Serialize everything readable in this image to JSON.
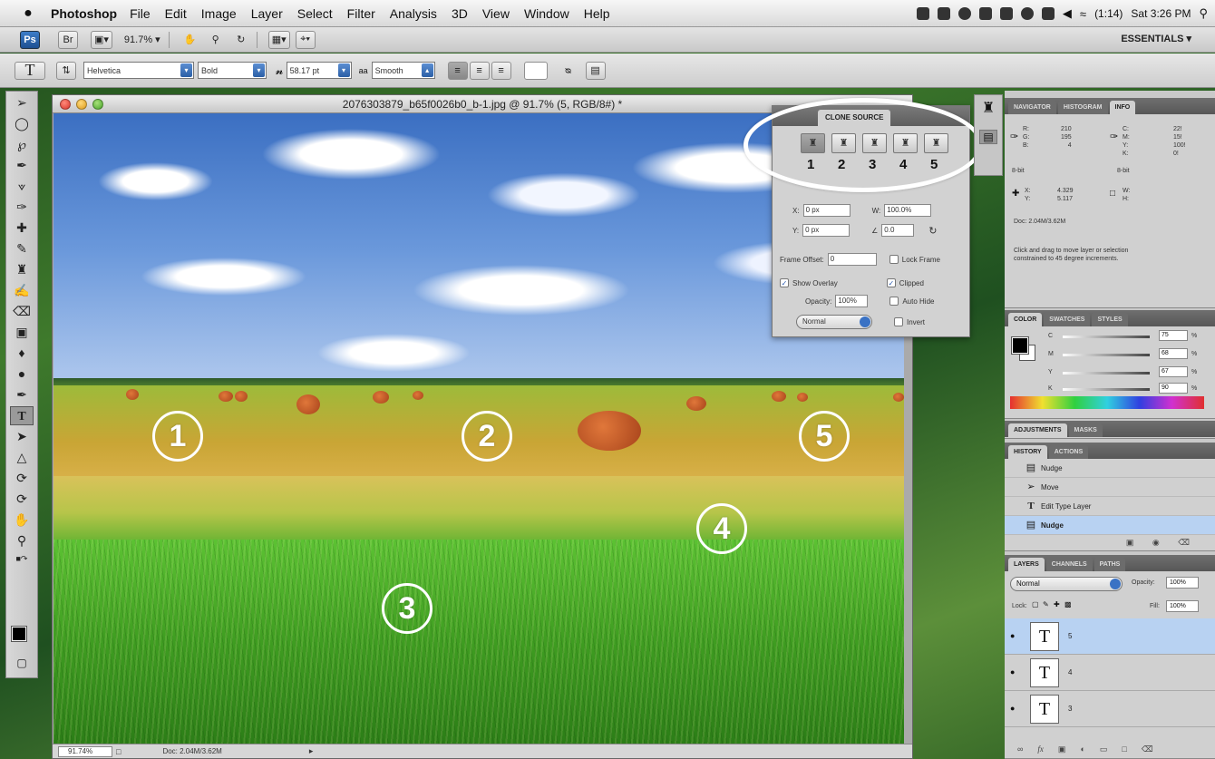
{
  "menubar": {
    "apple": "",
    "app_name": "Photoshop",
    "items": [
      "File",
      "Edit",
      "Image",
      "Layer",
      "Select",
      "Filter",
      "Analysis",
      "3D",
      "View",
      "Window",
      "Help"
    ],
    "battery": "(1:14)",
    "clock": "Sat 3:26 PM"
  },
  "appbar": {
    "ps_label": "Ps",
    "zoom": "91.7% ▾",
    "workspace": "ESSENTIALS ▾"
  },
  "options": {
    "tool_glyph": "T",
    "font_family": "Helvetica",
    "font_style": "Bold",
    "font_size": "58.17 pt",
    "antialias_label": "aa",
    "antialias": "Smooth"
  },
  "document": {
    "title": "2076303879_b65f0026b0_b-1.jpg @ 91.7% (5, RGB/8#) *",
    "zoom": "91.74%",
    "doc_size": "Doc: 2.04M/3.62M",
    "markers": [
      "1",
      "2",
      "3",
      "4",
      "5"
    ]
  },
  "clone_source": {
    "tab_label": "CLONE SOURCE",
    "numbers": [
      "1",
      "2",
      "3",
      "4",
      "5"
    ],
    "x_label": "X:",
    "x_value": "0 px",
    "y_label": "Y:",
    "y_value": "0 px",
    "w_label": "W:",
    "w_value": "100.0%",
    "h_label": "H:",
    "angle_value": "0.0",
    "frame_offset_label": "Frame Offset:",
    "frame_offset_value": "0",
    "lock_frame": "Lock Frame",
    "show_overlay": "Show Overlay",
    "clipped": "Clipped",
    "opacity_label": "Opacity:",
    "opacity_value": "100%",
    "auto_hide": "Auto Hide",
    "invert": "Invert",
    "blend_mode": "Normal"
  },
  "info_panel": {
    "tabs": [
      "NAVIGATOR",
      "HISTOGRAM",
      "INFO"
    ],
    "rgb_labels": "R:\nG:\nB:",
    "rgb_values": "210\n195\n4",
    "cmyk_labels": "C:\nM:\nY:\nK:",
    "cmyk_values": "22!\n15!\n100!\n0!",
    "bit_left": "8-bit",
    "bit_right": "8-bit",
    "xy_labels": "X:\nY:",
    "xy_values": "4.329\n5.117",
    "wh_labels": "W:\nH:",
    "doc": "Doc: 2.04M/3.62M",
    "hint": "Click and drag to move layer or selection\nconstrained to 45 degree increments."
  },
  "color_panel": {
    "tabs": [
      "COLOR",
      "SWATCHES",
      "STYLES"
    ],
    "channels": [
      {
        "label": "C",
        "value": "75"
      },
      {
        "label": "M",
        "value": "68"
      },
      {
        "label": "Y",
        "value": "67"
      },
      {
        "label": "K",
        "value": "90"
      }
    ],
    "unit": "%"
  },
  "adjust_panel": {
    "tabs": [
      "ADJUSTMENTS",
      "MASKS"
    ]
  },
  "history_panel": {
    "tabs": [
      "HISTORY",
      "ACTIONS"
    ],
    "items": [
      {
        "label": "Nudge",
        "icon": "nudge-icon"
      },
      {
        "label": "Move",
        "icon": "move-icon"
      },
      {
        "label": "Edit Type Layer",
        "icon": "type-icon"
      },
      {
        "label": "Nudge",
        "icon": "nudge-icon"
      }
    ]
  },
  "layers_panel": {
    "tabs": [
      "LAYERS",
      "CHANNELS",
      "PATHS"
    ],
    "blend_mode": "Normal",
    "opacity_label": "Opacity:",
    "opacity_value": "100%",
    "lock_label": "Lock:",
    "fill_label": "Fill:",
    "fill_value": "100%",
    "layers": [
      {
        "name": "5",
        "thumb": "T"
      },
      {
        "name": "4",
        "thumb": "T"
      },
      {
        "name": "3",
        "thumb": "T"
      }
    ]
  },
  "colors": {
    "selection": "#b8d2f2",
    "accent_blue": "#3a72c4"
  }
}
